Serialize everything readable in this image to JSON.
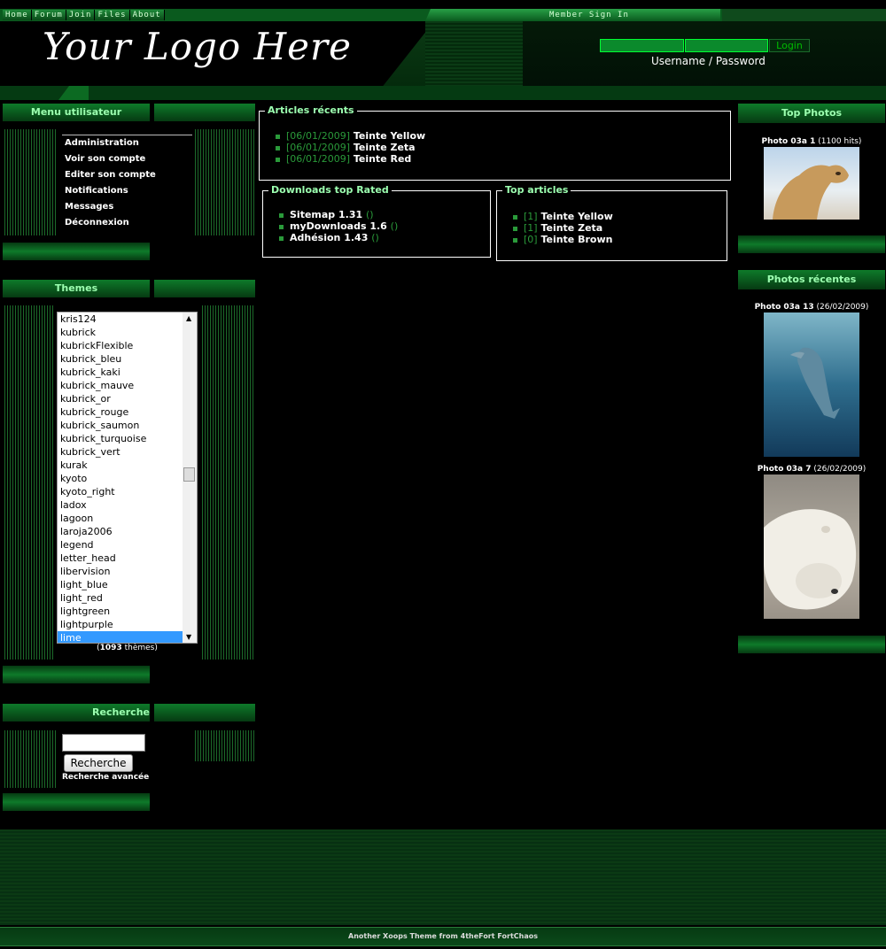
{
  "topnav": {
    "items": [
      "Home",
      "Forum",
      "Join",
      "Files",
      "About"
    ],
    "member_label": "Member Sign In"
  },
  "header": {
    "logo_text": "Your Logo Here",
    "login_button": "Login",
    "login_labels": "Username /  Password"
  },
  "menu_block": {
    "title": "Menu utilisateur",
    "items": [
      "Administration",
      "Voir son compte",
      "Editer son compte",
      "Notifications",
      "Messages",
      "Déconnexion"
    ]
  },
  "themes_block": {
    "title": "Themes",
    "items": [
      "kris124",
      "kubrick",
      "kubrickFlexible",
      "kubrick_bleu",
      "kubrick_kaki",
      "kubrick_mauve",
      "kubrick_or",
      "kubrick_rouge",
      "kubrick_saumon",
      "kubrick_turquoise",
      "kubrick_vert",
      "kurak",
      "kyoto",
      "kyoto_right",
      "ladox",
      "lagoon",
      "laroja2006",
      "legend",
      "letter_head",
      "libervision",
      "light_blue",
      "light_red",
      "lightgreen",
      "lightpurple",
      "lime"
    ],
    "selected": "lime",
    "count_number": "1093",
    "count_suffix": " thèmes)",
    "count_prefix": "("
  },
  "search_block": {
    "title": "Recherche",
    "button": "Recherche",
    "advanced": "Recherche avancée"
  },
  "recent_articles": {
    "title": "Articles récents",
    "items": [
      {
        "date": "[06/01/2009]",
        "title": "Teinte Yellow"
      },
      {
        "date": "[06/01/2009]",
        "title": "Teinte Zeta"
      },
      {
        "date": "[06/01/2009]",
        "title": "Teinte Red"
      }
    ]
  },
  "downloads_top": {
    "title": "Downloads top Rated",
    "items": [
      {
        "name": "Sitemap 1.31",
        "extra": "()"
      },
      {
        "name": "myDownloads 1.6",
        "extra": "()"
      },
      {
        "name": "Adhésion 1.43",
        "extra": "()"
      }
    ]
  },
  "top_articles": {
    "title": "Top articles",
    "items": [
      {
        "count": "[1]",
        "title": "Teinte Yellow"
      },
      {
        "count": "[1]",
        "title": "Teinte Zeta"
      },
      {
        "count": "[0]",
        "title": "Teinte Brown"
      }
    ]
  },
  "top_photos": {
    "title": "Top Photos",
    "caption_name": "Photo 03a 1",
    "caption_extra": " (1100 hits)"
  },
  "recent_photos": {
    "title": "Photos récentes",
    "photos": [
      {
        "name": "Photo 03a 13",
        "date": " (26/02/2009)"
      },
      {
        "name": "Photo 03a 7",
        "date": " (26/02/2009)"
      }
    ]
  },
  "footer": {
    "text": "Another Xoops Theme from 4theFort FortChaos"
  },
  "colors": {
    "accent_green": "#0e7a2a",
    "title_green": "#9cffb0",
    "background": "#000000"
  }
}
